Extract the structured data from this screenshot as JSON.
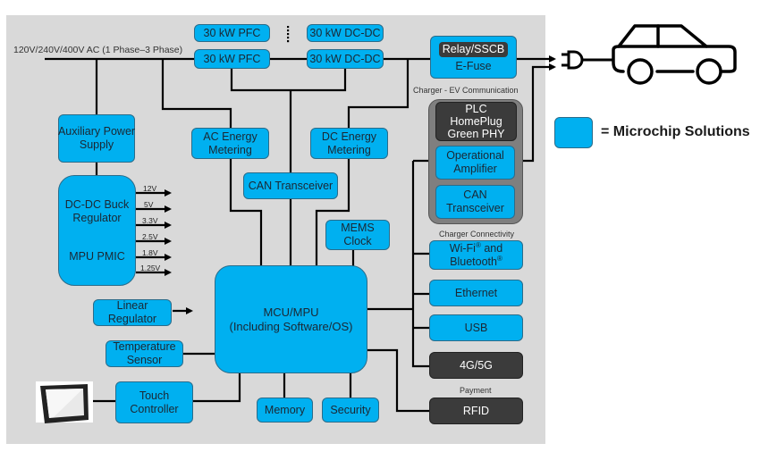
{
  "input_label": "120V/240V/400V AC (1 Phase–3 Phase)",
  "power_stage": {
    "pfc_top": "30 kW PFC",
    "pfc_bottom": "30 kW PFC",
    "dcdc_top": "30 kW DC-DC",
    "dcdc_bottom": "30 kW DC-DC",
    "ellipsis": "⋮"
  },
  "relay": {
    "top": "Relay/SSCB",
    "bottom": "E-Fuse"
  },
  "charger_ev_comm": {
    "heading": "Charger - EV Communication",
    "plc": [
      "PLC",
      "HomePlug",
      "Green PHY"
    ],
    "opamp": [
      "Operational",
      "Amplifier"
    ],
    "can": [
      "CAN",
      "Transceiver"
    ]
  },
  "aux_power": [
    "Auxiliary Power",
    "Supply"
  ],
  "pmic": {
    "line1": "DC-DC Buck",
    "line2": "Regulator",
    "line3": "MPU PMIC"
  },
  "voltages": [
    "12V",
    "5V",
    "3.3V",
    "2.5V",
    "1.8V",
    "1.25V"
  ],
  "ac_metering": [
    "AC Energy",
    "Metering"
  ],
  "dc_metering": [
    "DC Energy",
    "Metering"
  ],
  "can_transceiver": "CAN Transceiver",
  "mems_clock": [
    "MEMS",
    "Clock"
  ],
  "mcu": [
    "MCU/MPU",
    "(Including Software/OS)"
  ],
  "linear_regulator": [
    "Linear",
    "Regulator"
  ],
  "temp_sensor": [
    "Temperature",
    "Sensor"
  ],
  "touch_controller": [
    "Touch",
    "Controller"
  ],
  "memory": "Memory",
  "security": "Security",
  "connectivity": {
    "heading": "Charger Connectivity",
    "wifi_line1": "Wi-Fi",
    "wifi_line1_suffix": " and",
    "wifi_line2": "Bluetooth",
    "reg_mark": "®",
    "ethernet": "Ethernet",
    "usb": "USB",
    "cellular": "4G/5G"
  },
  "payment": {
    "heading": "Payment",
    "rfid": "RFID"
  },
  "legend": {
    "text": "= Microchip Solutions",
    "color": "#00b0f0"
  },
  "colors": {
    "microchip_blue": "#00b0f0",
    "third_party_dark": "#3b3b3b",
    "panel_gray": "#d9d9d9"
  }
}
